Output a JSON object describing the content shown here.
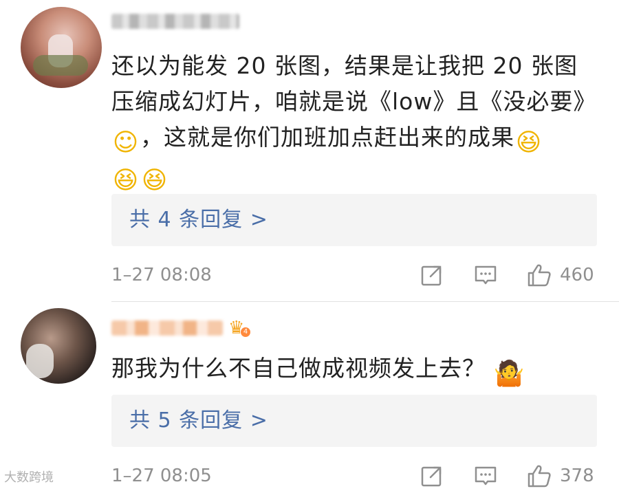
{
  "comments": [
    {
      "text_part1": "还以为能发 20 张图，结果是让我把 20 张图压缩成幻灯片，咱就是说《low》且《没必要》",
      "text_part2": "，这就是你们加班加点赶出来的成果",
      "reply_link": "共 4 条回复 >",
      "time": "1–27 08:08",
      "likes": "460"
    },
    {
      "text": "那我为什么不自己做成视频发上去？",
      "reply_link": "共 5 条回复 >",
      "time": "1–27 08:05",
      "likes": "378",
      "badge_level": "4"
    }
  ],
  "watermark": "大数跨境",
  "icons": {
    "share": "share-icon",
    "comment": "comment-icon",
    "like": "thumbs-up-icon",
    "crown": "crown-icon"
  },
  "colors": {
    "link": "#4a6ea8",
    "meta": "#8f8f8f",
    "reply_bg": "#f4f4f4"
  }
}
